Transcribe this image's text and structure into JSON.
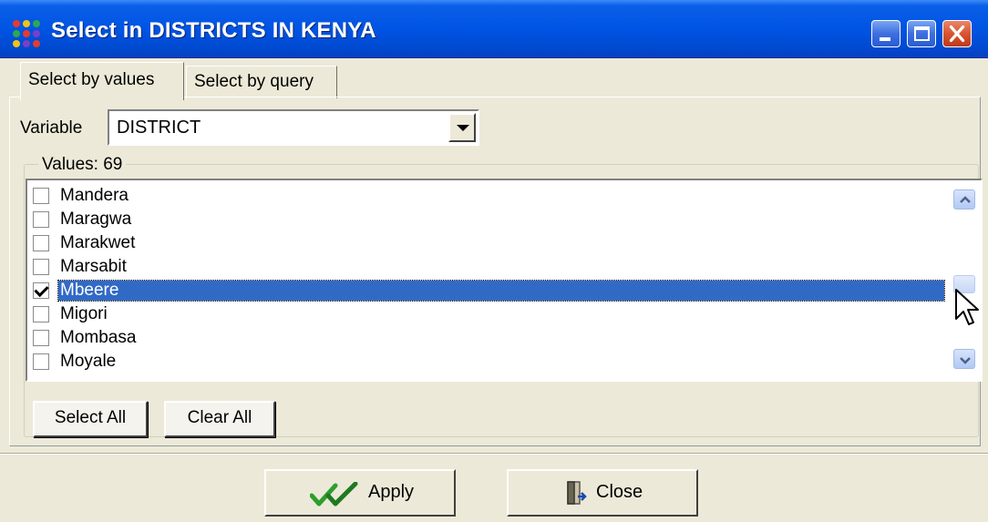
{
  "window": {
    "title": "Select in DISTRICTS IN KENYA"
  },
  "tabs": [
    {
      "label": "Select by values",
      "active": true
    },
    {
      "label": "Select by query",
      "active": false
    }
  ],
  "variable": {
    "label": "Variable",
    "value": "DISTRICT"
  },
  "values_group": {
    "legend": "Values: 69",
    "items": [
      {
        "label": "Mandera",
        "checked": false
      },
      {
        "label": "Maragwa",
        "checked": false
      },
      {
        "label": "Marakwet",
        "checked": false
      },
      {
        "label": "Marsabit",
        "checked": false
      },
      {
        "label": "Mbeere",
        "checked": true,
        "selected": true
      },
      {
        "label": "Migori",
        "checked": false
      },
      {
        "label": "Mombasa",
        "checked": false
      },
      {
        "label": "Moyale",
        "checked": false
      }
    ]
  },
  "buttons": {
    "select_all": "Select All",
    "clear_all": "Clear All",
    "apply": "Apply",
    "close": "Close"
  },
  "colors": {
    "titlebar": "#0054e3",
    "selection": "#316ac5",
    "apply_check": "#2e9e2e"
  }
}
